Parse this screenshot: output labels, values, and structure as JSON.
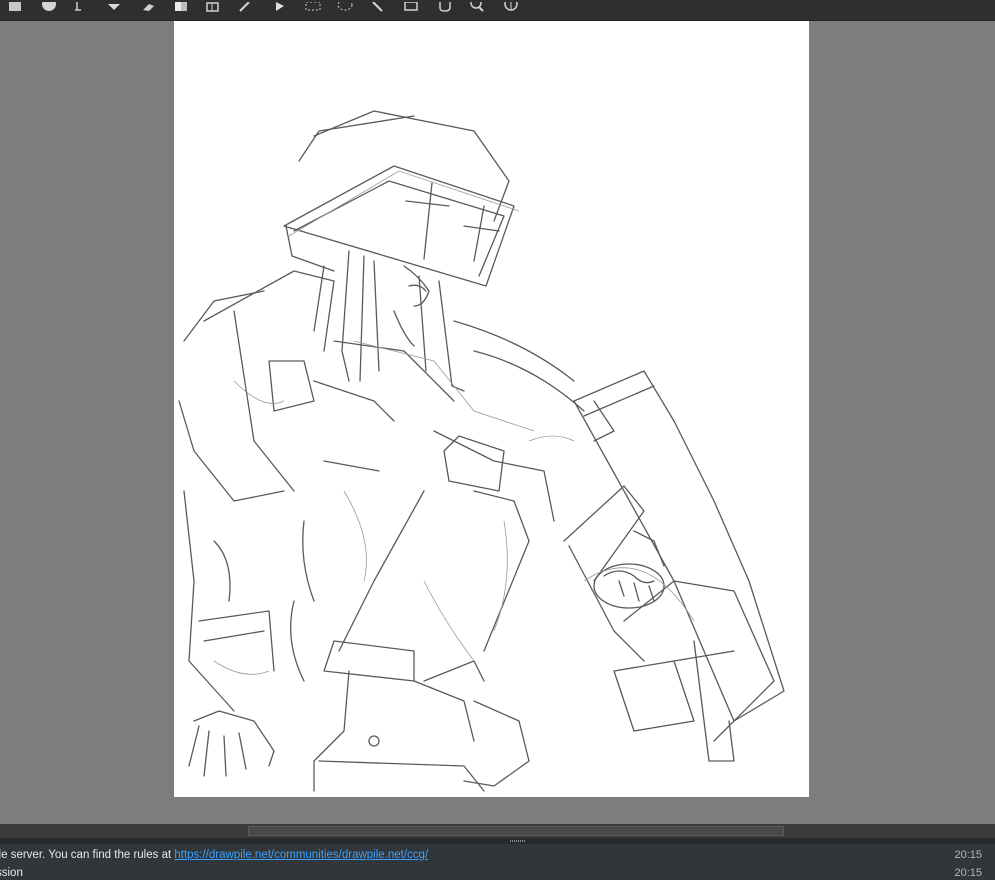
{
  "toolbar": {
    "tools": [
      {
        "id": "color-swatch",
        "icon": "square-swatch-icon"
      },
      {
        "id": "ellipse",
        "icon": "ellipse-icon"
      },
      {
        "id": "text",
        "icon": "text-tool-icon"
      },
      {
        "id": "bucket",
        "icon": "fill-bucket-icon"
      },
      {
        "id": "eraser",
        "icon": "eraser-icon"
      },
      {
        "id": "gradient",
        "icon": "gradient-icon"
      },
      {
        "id": "inspector",
        "icon": "inspector-icon"
      },
      {
        "id": "picker",
        "icon": "color-picker-icon"
      },
      {
        "id": "move",
        "icon": "move-arrow-icon"
      },
      {
        "id": "rect-select",
        "icon": "rect-select-icon"
      },
      {
        "id": "lasso",
        "icon": "lasso-select-icon"
      },
      {
        "id": "magic-wand",
        "icon": "magic-wand-icon"
      },
      {
        "id": "transform",
        "icon": "transform-icon"
      },
      {
        "id": "pan",
        "icon": "hand-pan-icon"
      },
      {
        "id": "zoom",
        "icon": "zoom-icon"
      },
      {
        "id": "rotate",
        "icon": "rotate-view-icon"
      }
    ]
  },
  "chat": {
    "lines": [
      {
        "text": "ile server. You can find the rules at ",
        "link": "https://drawpile.net/communities/drawpile.net/ccg/",
        "time": "20:15"
      },
      {
        "text": "ssion",
        "time": "20:15"
      }
    ]
  },
  "colors": {
    "toolbar_bg": "#2f2f2f",
    "canvas_area_bg": "#7d7d7d",
    "canvas_bg": "#ffffff",
    "chat_bg": "#31363b",
    "link": "#3da2ff"
  }
}
